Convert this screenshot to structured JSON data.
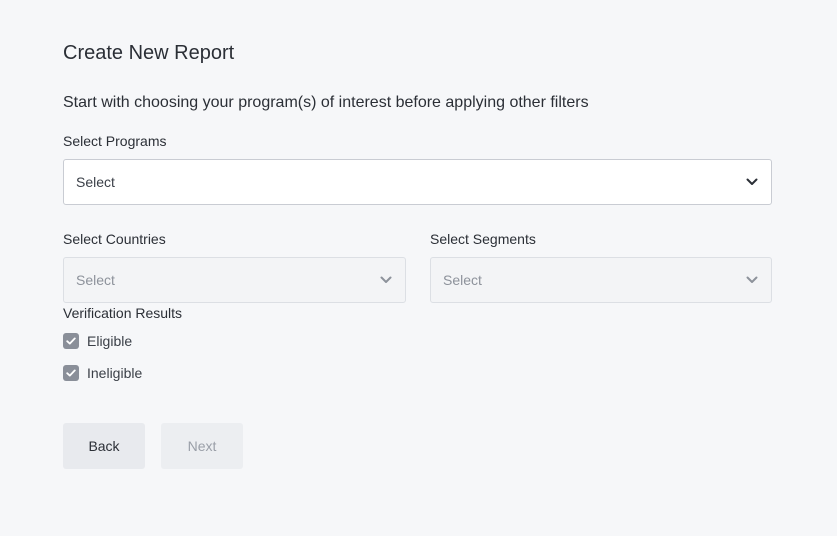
{
  "page": {
    "title": "Create New Report",
    "subtitle": "Start with choosing your program(s) of interest before applying other filters"
  },
  "programs": {
    "label": "Select Programs",
    "value": "Select"
  },
  "countries": {
    "label": "Select Countries",
    "value": "Select"
  },
  "segments": {
    "label": "Select Segments",
    "value": "Select"
  },
  "verification": {
    "label": "Verification Results",
    "options": [
      {
        "label": "Eligible",
        "checked": true
      },
      {
        "label": "Ineligible",
        "checked": true
      }
    ]
  },
  "actions": {
    "back_label": "Back",
    "next_label": "Next"
  },
  "icons": {
    "dropdown": "chevron-down-icon",
    "check": "check-icon"
  },
  "colors": {
    "background": "#f6f7f9",
    "checkbox_fill": "#8a8f99",
    "text": "#2b2f36"
  }
}
